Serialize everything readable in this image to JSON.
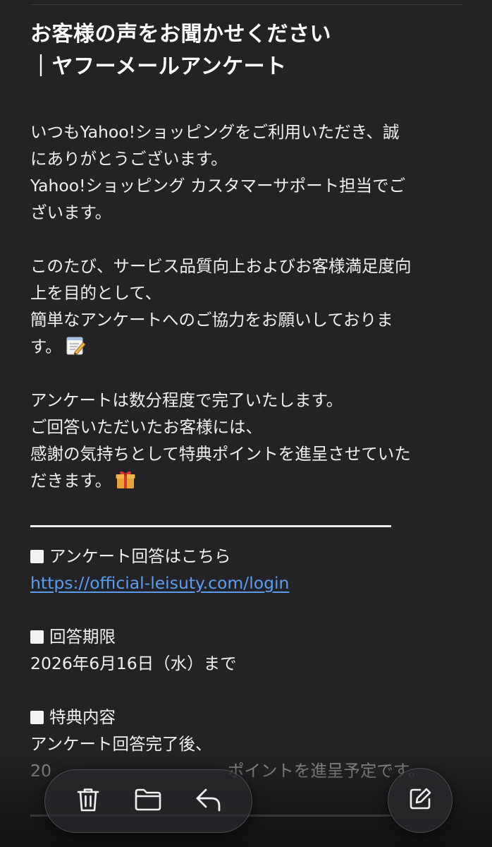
{
  "email": {
    "title": {
      "line1": "お客様の声をお聞かせください",
      "line2": "｜ヤフーメールアンケート"
    },
    "para1": [
      "いつもYahoo!ショッピングをご利用いただき、誠",
      "にありがとうございます。",
      "Yahoo!ショッピング カスタマーサポート担当でご",
      "ざいます。"
    ],
    "para2": [
      "このたび、サービス品質向上およびお客様満足度向",
      "上を目的として、",
      "簡単なアンケートへのご協力をお願いしておりま",
      "す。"
    ],
    "para3": [
      "アンケートは数分程度で完了いたします。",
      "ご回答いただいたお客様には、",
      "感謝の気持ちとして特典ポイントを進呈させていた",
      "だきます。"
    ],
    "survey": {
      "heading": "アンケート回答はこちら",
      "link": "https://official-leisuty.com/login"
    },
    "deadline": {
      "heading": "回答期限",
      "value": "2026年6月16日（水）まで"
    },
    "benefit": {
      "heading": "特典内容",
      "line1": "アンケート回答完了後、",
      "line2_prefix": "20",
      "line2_suffix": "ポイントを進呈予定です。"
    }
  },
  "toolbar": {
    "icons": [
      "trash-icon",
      "folder-icon",
      "reply-icon"
    ],
    "compose_icon": "compose-icon"
  },
  "colors": {
    "background": "#232325",
    "text": "#f0f0f0",
    "link": "#5a9df0"
  }
}
